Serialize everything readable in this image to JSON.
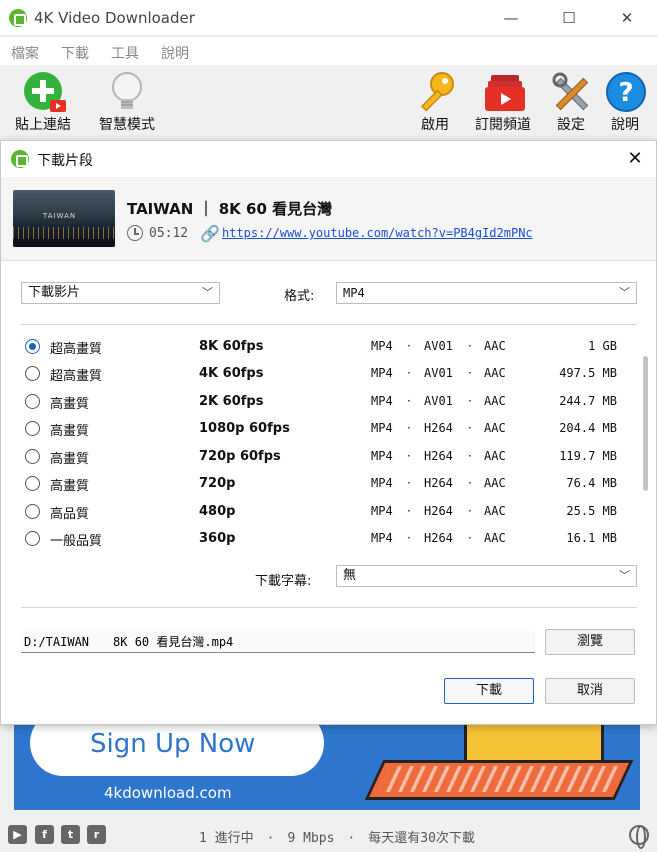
{
  "app": {
    "title": "4K Video Downloader",
    "window_controls": {
      "minimize": "—",
      "maximize": "☐",
      "close": "✕"
    }
  },
  "menu": [
    "檔案",
    "下載",
    "工具",
    "說明"
  ],
  "toolbar": {
    "paste_link": "貼上連結",
    "smart_mode": "智慧模式",
    "activate": "啟用",
    "subscriptions": "訂閱頻道",
    "settings": "設定",
    "help": "說明"
  },
  "dialog": {
    "title": "下載片段",
    "close": "✕",
    "video": {
      "title": "TAIWAN ｜ 8K 60 看見台灣",
      "thumbnail_text": "TAIWAN",
      "duration": "05:12",
      "url": "https://www.youtube.com/watch?v=PB4gId2mPNc"
    },
    "mode_select": "下載影片",
    "format_label": "格式:",
    "format_value": "MP4",
    "qualities": [
      {
        "name": "超高畫質",
        "resolution": "8K 60fps",
        "container": "MP4",
        "video_codec": "AV01",
        "audio_codec": "AAC",
        "size": "1 GB",
        "selected": true
      },
      {
        "name": "超高畫質",
        "resolution": "4K 60fps",
        "container": "MP4",
        "video_codec": "AV01",
        "audio_codec": "AAC",
        "size": "497.5 MB",
        "selected": false
      },
      {
        "name": "高畫質",
        "resolution": "2K 60fps",
        "container": "MP4",
        "video_codec": "AV01",
        "audio_codec": "AAC",
        "size": "244.7 MB",
        "selected": false
      },
      {
        "name": "高畫質",
        "resolution": "1080p 60fps",
        "container": "MP4",
        "video_codec": "H264",
        "audio_codec": "AAC",
        "size": "204.4 MB",
        "selected": false
      },
      {
        "name": "高畫質",
        "resolution": "720p 60fps",
        "container": "MP4",
        "video_codec": "H264",
        "audio_codec": "AAC",
        "size": "119.7 MB",
        "selected": false
      },
      {
        "name": "高畫質",
        "resolution": "720p",
        "container": "MP4",
        "video_codec": "H264",
        "audio_codec": "AAC",
        "size": "76.4 MB",
        "selected": false
      },
      {
        "name": "高品質",
        "resolution": "480p",
        "container": "MP4",
        "video_codec": "H264",
        "audio_codec": "AAC",
        "size": "25.5 MB",
        "selected": false
      },
      {
        "name": "一般品質",
        "resolution": "360p",
        "container": "MP4",
        "video_codec": "H264",
        "audio_codec": "AAC",
        "size": "16.1 MB",
        "selected": false
      }
    ],
    "separator": "·",
    "subtitle_label": "下載字幕:",
    "subtitle_value": "無",
    "save_path": "D:/TAIWAN　　8K 60 看見台灣.mp4",
    "browse_button": "瀏覽",
    "download_button": "下載",
    "cancel_button": "取消"
  },
  "ad": {
    "headline": "Sign Up Now",
    "url": "4kdownload.com",
    "background_color": "#2e76cd"
  },
  "status": {
    "text": "1 進行中　·　9 Mbps　·　每天還有30次下載",
    "social_icons": [
      "youtube-icon",
      "facebook-icon",
      "twitter-icon",
      "reddit-icon"
    ]
  }
}
